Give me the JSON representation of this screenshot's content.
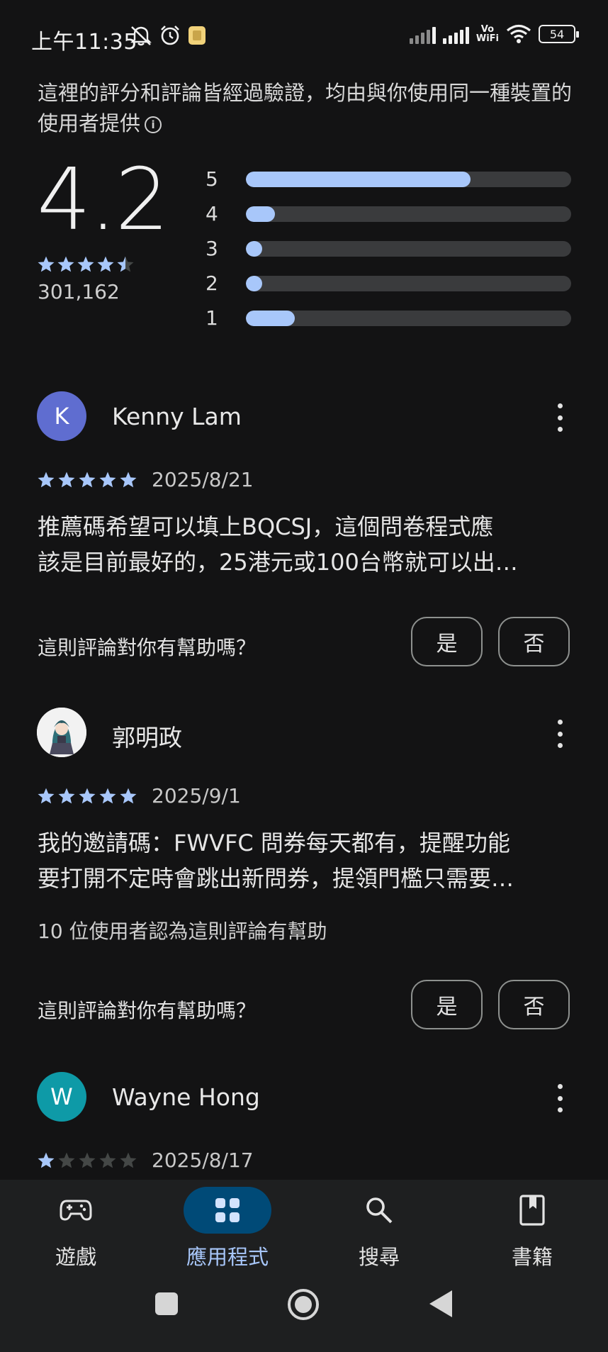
{
  "status_bar": {
    "time": "上午11:35",
    "battery": "54",
    "vowifi_top": "Vo",
    "vowifi_bottom": "WiFi"
  },
  "header": {
    "verified_note": "這裡的評分和評論皆經過驗證，均由與你使用同一種裝置的使用者提供"
  },
  "summary": {
    "rating": "4.2",
    "stars": 4.5,
    "count": "301,162",
    "distribution": [
      {
        "label": "5",
        "fraction": 0.69
      },
      {
        "label": "4",
        "fraction": 0.09
      },
      {
        "label": "3",
        "fraction": 0.05
      },
      {
        "label": "2",
        "fraction": 0.05
      },
      {
        "label": "1",
        "fraction": 0.15
      }
    ]
  },
  "reviews": [
    {
      "name": "Kenny Lam",
      "avatar_letter": "K",
      "avatar_color": "#5f6dd0",
      "stars": 5,
      "date": "2025/8/21",
      "text_line1": "推薦碼希望可以填上BQCSJ，這個問卷程式應",
      "text_line2": "該是目前最好的，25港元或100台幣就可以出…",
      "helpful_count": "",
      "helpful_question": "這則評論對你有幫助嗎？",
      "yes": "是",
      "no": "否"
    },
    {
      "name": "郭明政",
      "avatar_letter": "",
      "avatar_color": "#f2f2f2",
      "stars": 5,
      "date": "2025/9/1",
      "text_line1": "我的邀請碼：FWVFC 問券每天都有，提醒功能",
      "text_line2": "要打開不定時會跳出新問券，提領門檻只需要…",
      "helpful_count": "10 位使用者認為這則評論有幫助",
      "helpful_question": "這則評論對你有幫助嗎？",
      "yes": "是",
      "no": "否"
    },
    {
      "name": "Wayne Hong",
      "avatar_letter": "W",
      "avatar_color": "#0e9aa7",
      "stars": 1,
      "date": "2025/8/17"
    }
  ],
  "bottom_nav": [
    {
      "label": "遊戲",
      "icon": "gamepad-icon",
      "active": false
    },
    {
      "label": "應用程式",
      "icon": "apps-icon",
      "active": true
    },
    {
      "label": "搜尋",
      "icon": "search-icon",
      "active": false
    },
    {
      "label": "書籍",
      "icon": "book-icon",
      "active": false
    }
  ],
  "colors": {
    "background": "#131314",
    "accent": "#a8c7fa",
    "star": "#a8c7fa",
    "star_empty": "#444746",
    "active_pill": "#004a77"
  }
}
